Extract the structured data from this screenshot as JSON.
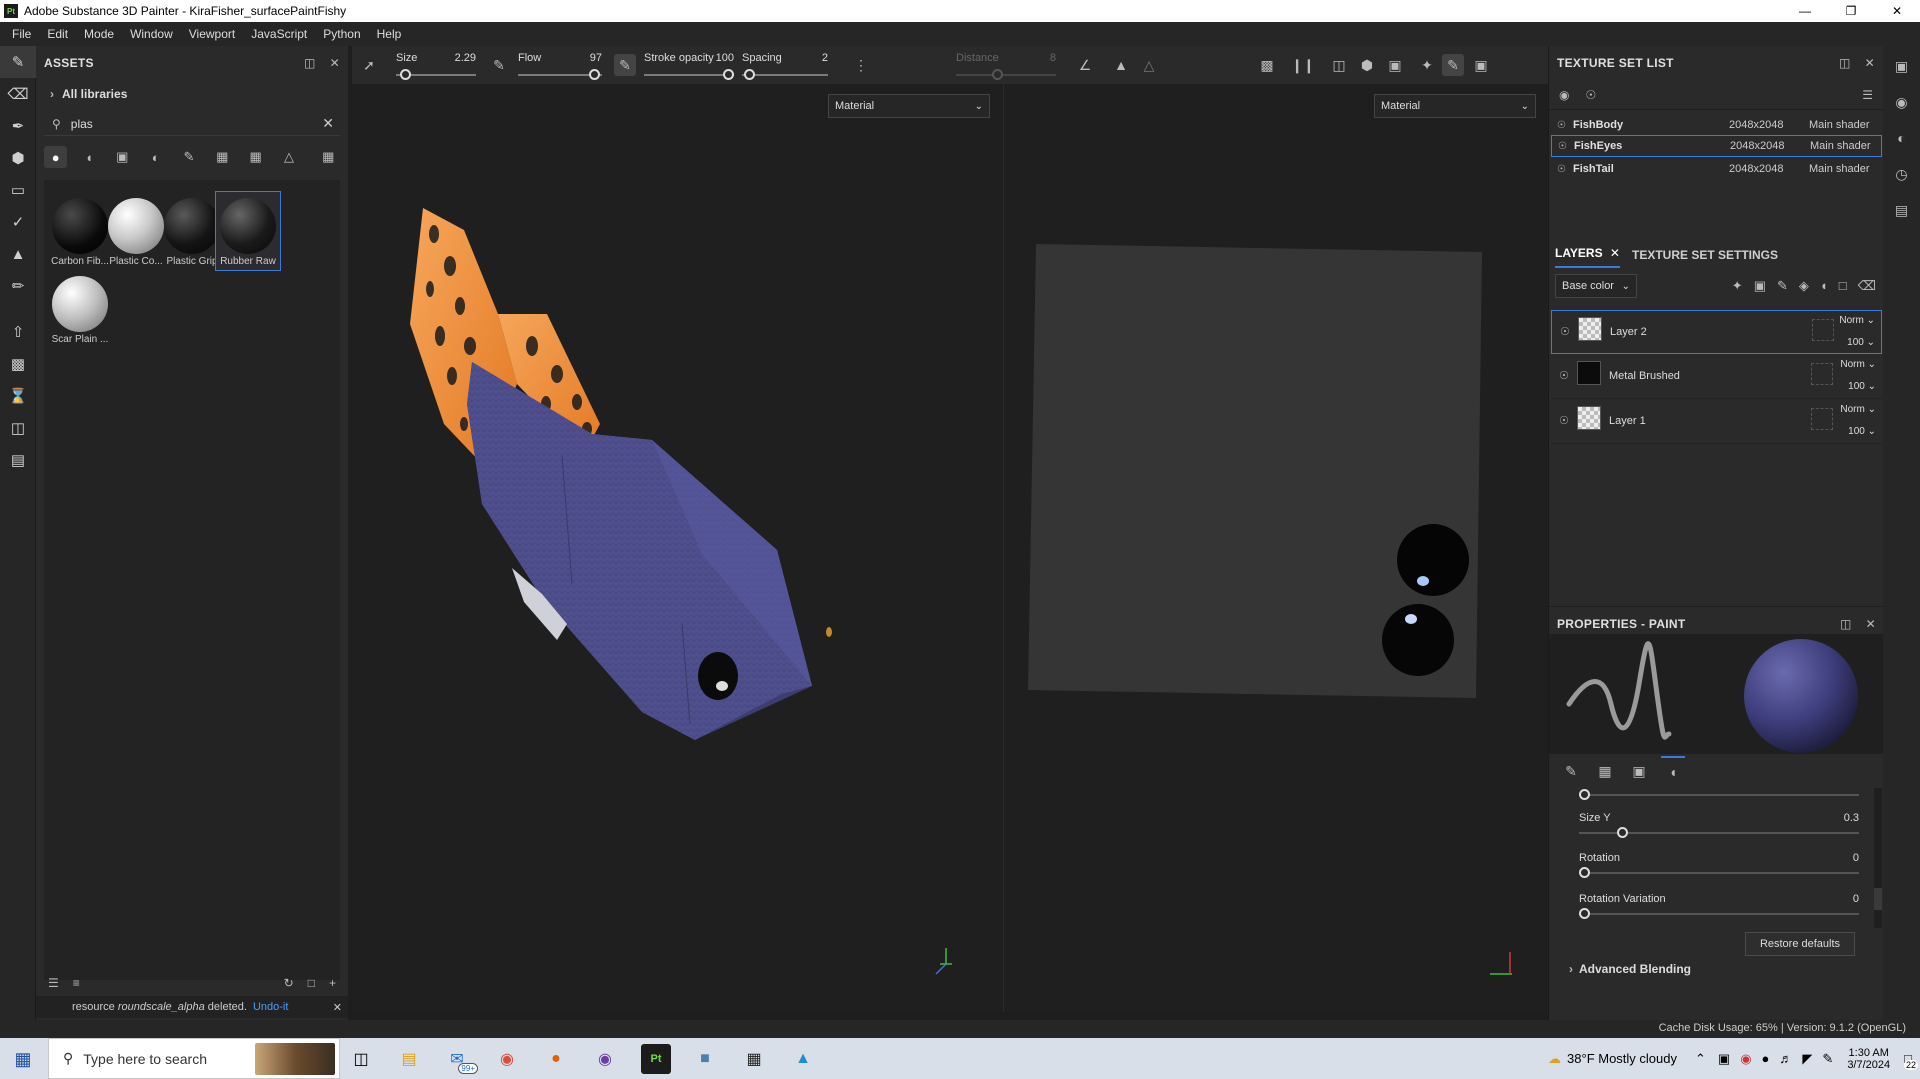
{
  "window": {
    "title": "Adobe Substance 3D Painter - KiraFisher_surfacePaintFishy",
    "logo": "Pt"
  },
  "menu": [
    "File",
    "Edit",
    "Mode",
    "Window",
    "Viewport",
    "JavaScript",
    "Python",
    "Help"
  ],
  "assets": {
    "title": "ASSETS",
    "library": "All libraries",
    "search_value": "plas",
    "materials": [
      {
        "label": "Carbon Fib...",
        "color": "#0d0d0d",
        "selected": false
      },
      {
        "label": "Plastic Co...",
        "color": "#cfcfcf",
        "selected": false
      },
      {
        "label": "Plastic Grip",
        "color": "#151515",
        "selected": false
      },
      {
        "label": "Rubber Raw",
        "color": "#181818",
        "selected": true
      },
      {
        "label": "Scar Plain ...",
        "color": "#d0d0d0",
        "selected": false
      }
    ],
    "status_msg_pre": "resource",
    "status_msg_item": "roundscale_alpha",
    "status_msg_post": "deleted.",
    "undo_label": "Undo-it"
  },
  "context": {
    "size_label": "Size",
    "size_value": "2.29",
    "size_fraction": 0.06,
    "flow_label": "Flow",
    "flow_value": "97",
    "flow_fraction": 0.97,
    "opacity_label": "Stroke opacity",
    "opacity_value": "100",
    "opacity_fraction": 1.0,
    "spacing_label": "Spacing",
    "spacing_value": "2",
    "spacing_fraction": 0.02,
    "distance_label": "Distance",
    "distance_value": "8",
    "distance_fraction": 0.4
  },
  "viewport": {
    "material_3d": "Material",
    "material_2d": "Material"
  },
  "texture_set_list": {
    "title": "TEXTURE SET LIST",
    "sets": [
      {
        "name": "FishBody",
        "res": "2048x2048",
        "shader": "Main shader",
        "selected": false
      },
      {
        "name": "FishEyes",
        "res": "2048x2048",
        "shader": "Main shader",
        "selected": true
      },
      {
        "name": "FishTail",
        "res": "2048x2048",
        "shader": "Main shader",
        "selected": false
      }
    ]
  },
  "layers": {
    "tab_layers": "LAYERS",
    "tab_settings": "TEXTURE SET SETTINGS",
    "channel": "Base color",
    "items": [
      {
        "name": "Layer 2",
        "blend": "Norm",
        "opacity": "100",
        "selected": true
      },
      {
        "name": "Metal Brushed",
        "blend": "Norm",
        "opacity": "100",
        "selected": false
      },
      {
        "name": "Layer 1",
        "blend": "Norm",
        "opacity": "100",
        "selected": false
      }
    ]
  },
  "properties": {
    "title": "PROPERTIES - PAINT",
    "size_y_label": "Size Y",
    "size_y_value": "0.3",
    "rotation_label": "Rotation",
    "rotation_value": "0",
    "rotvar_label": "Rotation Variation",
    "rotvar_value": "0",
    "restore_label": "Restore defaults",
    "adv_label": "Advanced Blending"
  },
  "statusbar": {
    "text": "Cache Disk Usage:  65% | Version: 9.1.2 (OpenGL)"
  },
  "taskbar": {
    "search_placeholder": "Type here to search",
    "weather": "38°F  Mostly cloudy",
    "time": "1:30 AM",
    "date": "3/7/2024",
    "mail_badge": "99+",
    "notif_count": "22"
  },
  "colors": {
    "accent": "#3e7bd6",
    "fish_body": "#4f4f8e",
    "fin_orange": "#f0923e"
  }
}
